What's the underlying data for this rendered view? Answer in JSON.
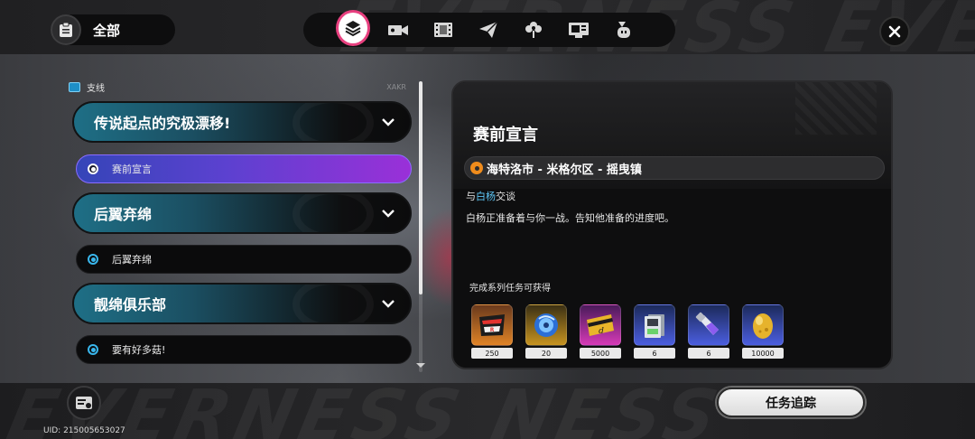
{
  "top_bar": {
    "filter_label": "全部",
    "tabs": [
      {
        "name": "all-quests",
        "icon": "layers-icon",
        "active": true
      },
      {
        "name": "main-story",
        "icon": "film-camera-icon",
        "active": false
      },
      {
        "name": "commissions",
        "icon": "film-strip-icon",
        "active": false
      },
      {
        "name": "errands",
        "icon": "paper-plane-icon",
        "active": false
      },
      {
        "name": "events",
        "icon": "flower-icon",
        "active": false
      },
      {
        "name": "videos",
        "icon": "screen-icon",
        "active": false
      },
      {
        "name": "bangboo",
        "icon": "bangboo-icon",
        "active": false
      }
    ],
    "close_icon": "close-icon"
  },
  "quest_list": {
    "category_label": "支线",
    "category_deco": "XAKR",
    "groups": [
      {
        "title": "传说起点的究极漂移!",
        "items": [
          {
            "label": "赛前宣言",
            "active": true
          }
        ]
      },
      {
        "title": "后翼弃绵",
        "items": [
          {
            "label": "后翼弃绵",
            "active": false
          }
        ]
      },
      {
        "title": "靓绵俱乐部",
        "items": [
          {
            "label": "要有好多菇!",
            "active": false
          }
        ]
      }
    ]
  },
  "detail": {
    "title": "赛前宣言",
    "location": "海特洛市 - 米格尔区 - 摇曳镇",
    "objective_prefix": "与",
    "objective_name": "白杨",
    "objective_suffix": "交谈",
    "description": "白杨正准备着与你一战。告知他准备的进度吧。",
    "rewards_label": "完成系列任务可获得",
    "rewards": [
      {
        "icon": "race-badge-icon",
        "qty": "250",
        "rarity": "orange"
      },
      {
        "icon": "polychrome-orb-icon",
        "qty": "20",
        "rarity": "gold"
      },
      {
        "icon": "dennies-card-icon",
        "qty": "5000",
        "rarity": "pink"
      },
      {
        "icon": "tape-icon",
        "qty": "6",
        "rarity": "blue"
      },
      {
        "icon": "material-tube-icon",
        "qty": "6",
        "rarity": "blue"
      },
      {
        "icon": "golden-egg-icon",
        "qty": "10000",
        "rarity": "blue"
      }
    ]
  },
  "footer": {
    "uid": "UID: 215005653027",
    "track_button": "任务追踪",
    "archive_icon": "archive-icon"
  },
  "colors": {
    "accent_pink": "#e8407f",
    "active_quest_start": "#3545b8",
    "active_quest_end": "#9a30d8",
    "header_teal": "#1e6f86",
    "highlight_blue": "#5fc7f6",
    "pin_orange": "#f08c1c"
  }
}
